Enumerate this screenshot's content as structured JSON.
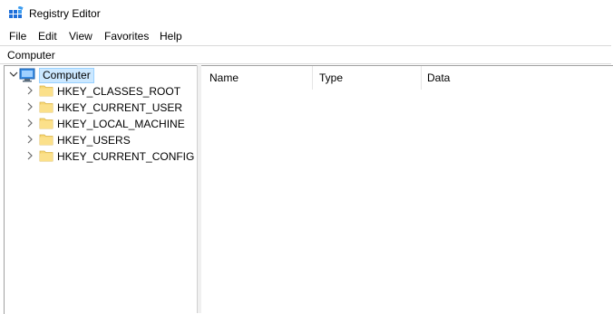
{
  "window": {
    "title": "Registry Editor"
  },
  "menu": [
    "File",
    "Edit",
    "View",
    "Favorites",
    "Help"
  ],
  "address": {
    "path": "Computer"
  },
  "tree": {
    "root": {
      "label": "Computer",
      "expanded": true,
      "selected": true
    },
    "hives": [
      {
        "label": "HKEY_CLASSES_ROOT"
      },
      {
        "label": "HKEY_CURRENT_USER"
      },
      {
        "label": "HKEY_LOCAL_MACHINE"
      },
      {
        "label": "HKEY_USERS"
      },
      {
        "label": "HKEY_CURRENT_CONFIG"
      }
    ]
  },
  "list": {
    "columns": [
      "Name",
      "Type",
      "Data"
    ]
  },
  "icons": {
    "app": "registry-editor-icon",
    "root": "computer-icon",
    "hive": "folder-icon",
    "expand": "chevron-right-icon",
    "collapse": "chevron-down-icon"
  },
  "colors": {
    "selection_bg": "#cce8ff",
    "selection_border": "#99d1ff",
    "folder": "#f8d775",
    "app_icon": "#1e90ff"
  }
}
